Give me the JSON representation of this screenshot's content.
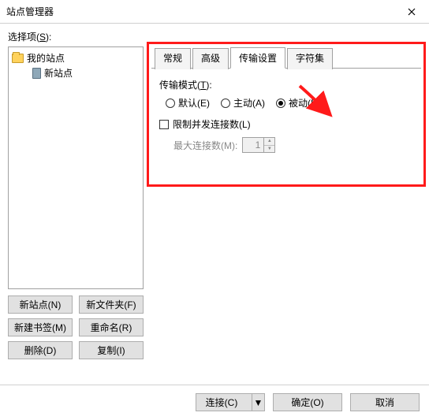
{
  "window": {
    "title": "站点管理器"
  },
  "select_label_pre": "选择项(",
  "select_label_key": "S",
  "select_label_post": "):",
  "tree": {
    "root": "我的站点",
    "child": "新站点"
  },
  "left_buttons": {
    "new_site": "新站点(N)",
    "new_folder": "新文件夹(F)",
    "new_bookmark": "新建书签(M)",
    "rename": "重命名(R)",
    "delete": "删除(D)",
    "copy": "复制(I)"
  },
  "tabs": {
    "general": "常规",
    "advanced": "高级",
    "transfer": "传输设置",
    "charset": "字符集"
  },
  "panel": {
    "mode_label_pre": "传输模式(",
    "mode_label_key": "T",
    "mode_label_post": "):",
    "radio_default": "默认(E)",
    "radio_active": "主动(A)",
    "radio_passive": "被动(P)",
    "limit_label": "限制并发连接数(L)",
    "max_conn_label": "最大连接数(M):",
    "max_conn_value": "1"
  },
  "footer": {
    "connect": "连接(C)",
    "ok": "确定(O)",
    "cancel": "取消"
  }
}
